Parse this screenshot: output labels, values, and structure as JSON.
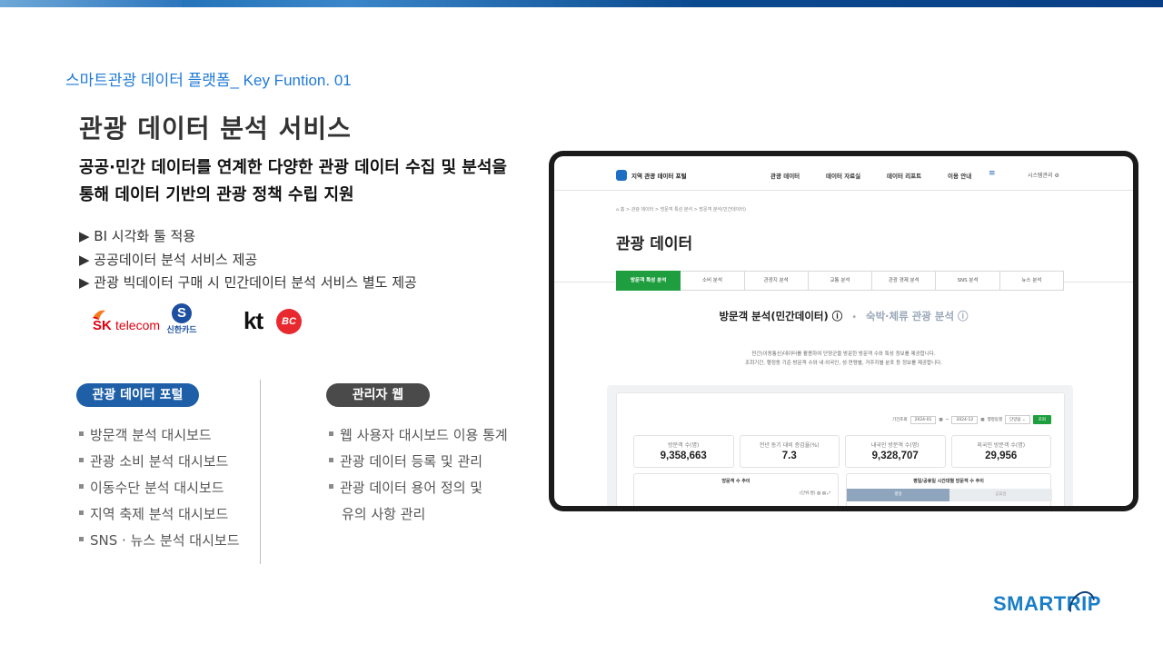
{
  "kicker": "스마트관광 데이터 플랫폼_ Key Funtion. 01",
  "title": "관광 데이터 분석 서비스",
  "subtitle": {
    "line1": "공공·민간 데이터를 연계한 다양한 관광 데이터 수집 및 분석을",
    "line2": "통해 데이터 기반의 관광 정책 수립 지원"
  },
  "features": [
    "▶ BI 시각화 툴 적용",
    "▶ 공공데이터 분석 서비스 제공",
    "▶ 관광 빅데이터 구매 시 민간데이터 분석 서비스 별도 제공"
  ],
  "partners": {
    "sk": {
      "mark": "SK",
      "name": "telecom"
    },
    "shinhan": {
      "mark": "S",
      "name": "신한카드"
    },
    "kt": "kt",
    "bc": "BC"
  },
  "portal": {
    "pill": "관광 데이터 포털",
    "items": [
      "방문객 분석 대시보드",
      "관광 소비 분석 대시보드",
      "이동수단 분석 대시보드",
      "지역 축제 분석 대시보드",
      "SNS · 뉴스 분석 대시보드"
    ]
  },
  "admin": {
    "pill": "관리자  웹",
    "items": [
      "웹 사용자 대시보드 이용 통계",
      "관광 데이터 등록 및 관리",
      "관광 데이터 용어 정의 및",
      "유의 사항 관리"
    ]
  },
  "brand": "SMARTRIP",
  "colors": {
    "accent_blue": "#1f7ad6",
    "pill_blue": "#1f5fa8",
    "pill_gray": "#4a4a4a",
    "screen_green": "#1e9e3e"
  },
  "screen": {
    "logo_text": "지역 관광 데이터 포털",
    "menu": [
      "관광 데이터",
      "데이터 자료실",
      "데이터 리포트",
      "이용 안내"
    ],
    "system": "시스템관리 ⚙",
    "breadcrumb": "⌂ 홈  >  관광 데이터  >  방문객 특성 분석  >  방문객 분석(민간데이터)",
    "heading": "관광 데이터",
    "tabs": [
      "방문객 특성 분석",
      "소비 분석",
      "관광지 분석",
      "교통 분석",
      "관광 경제 분석",
      "SNS 분석",
      "뉴스 분석"
    ],
    "section_a": "방문객 분석(민간데이터) ⓘ",
    "section_sep": "•",
    "section_b": "숙박·체류 관광 분석 ⓘ",
    "desc1": "민간(이동통신)데이터를 활용하여 단양군을 방문한 방문객 수와 특성 정보를 제공합니다.",
    "desc2": "조회기간, 행정동 기준 방문객 수와 내·외국인, 성·연령별, 거주지별 분포 등 정보를 제공합니다.",
    "filter": {
      "label": "기간조회",
      "from": "2024-01",
      "to": "2024-12",
      "region_label": "행정동별",
      "region_value": "단양읍",
      "button": "조회"
    },
    "stats": [
      {
        "label": "방문객 수(명)",
        "value": "9,358,663"
      },
      {
        "label": "전년 동기 대비 증감율(%)",
        "value": "7.3"
      },
      {
        "label": "내국인 방문객 수(명)",
        "value": "9,328,707"
      },
      {
        "label": "외국인 방문객 수(명)",
        "value": "29,956"
      }
    ],
    "chart1_title": "방문객 수 추이",
    "chart1_unit": "(단위:명)",
    "chart2_title": "평일/공휴일 시간대별 방문객 수 추이",
    "chart2_seg": [
      "평일",
      "공휴일"
    ]
  }
}
